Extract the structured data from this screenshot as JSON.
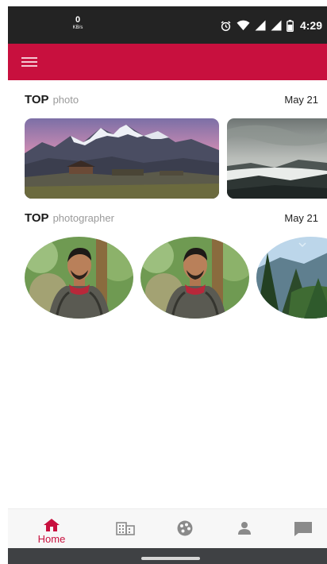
{
  "status_bar": {
    "net_speed_value": "0",
    "net_speed_unit": "KB/s",
    "time": "4:29",
    "icons": [
      "alarm-icon",
      "wifi-icon",
      "signal-icon",
      "signal-icon",
      "battery-icon"
    ]
  },
  "app_bar": {
    "color": "#c8103e",
    "menu_icon": "hamburger-menu-icon"
  },
  "sections": {
    "top_photo": {
      "title": "TOP",
      "subtitle": "photo",
      "date": "May 21",
      "items": [
        {
          "type": "landscape-photo",
          "content": "snowy mountains at dusk with a wooden hut"
        },
        {
          "type": "landscape-photo",
          "content": "misty valley with clouds (partially visible)"
        }
      ]
    },
    "top_photographer": {
      "title": "TOP",
      "subtitle": "photographer",
      "date": "May 21",
      "items": [
        {
          "type": "avatar",
          "content": "man in patterned shirt with red scarf"
        },
        {
          "type": "avatar",
          "content": "man in patterned shirt with red scarf"
        },
        {
          "type": "avatar",
          "content": "pine forest and mountains (partially visible)"
        }
      ]
    }
  },
  "bottom_nav": {
    "accent_color": "#c8103e",
    "items": [
      {
        "icon": "home-icon",
        "label": "Home",
        "active": true
      },
      {
        "icon": "building-icon",
        "active": false
      },
      {
        "icon": "palette-icon",
        "active": false
      },
      {
        "icon": "person-icon",
        "active": false
      },
      {
        "icon": "chat-icon",
        "active": false
      }
    ]
  }
}
